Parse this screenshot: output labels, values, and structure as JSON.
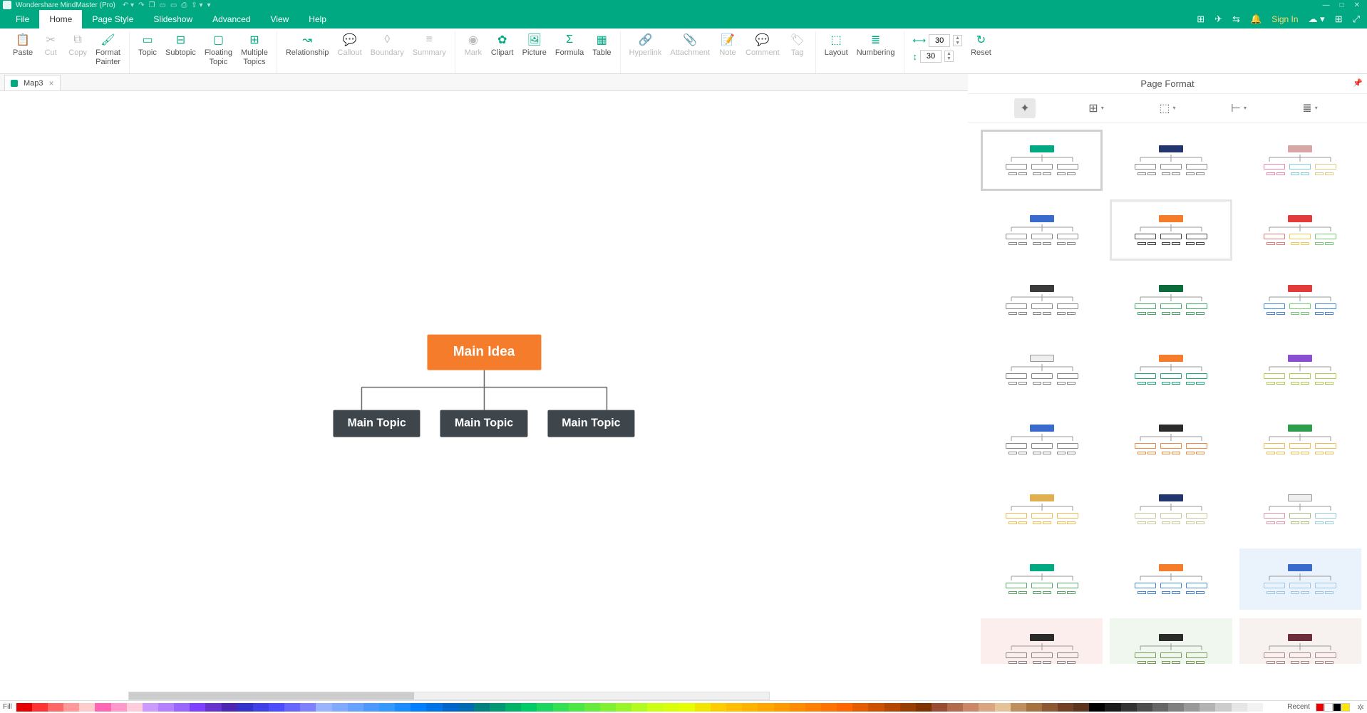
{
  "app": {
    "title": "Wondershare MindMaster (Pro)"
  },
  "menu": {
    "tabs": [
      "File",
      "Home",
      "Page Style",
      "Slideshow",
      "Advanced",
      "View",
      "Help"
    ],
    "active": 1,
    "signin": "Sign In"
  },
  "ribbon": {
    "paste": "Paste",
    "cut": "Cut",
    "copy": "Copy",
    "format_painter": "Format\nPainter",
    "topic": "Topic",
    "subtopic": "Subtopic",
    "floating": "Floating\nTopic",
    "multiple": "Multiple\nTopics",
    "relationship": "Relationship",
    "callout": "Callout",
    "boundary": "Boundary",
    "summary": "Summary",
    "mark": "Mark",
    "clipart": "Clipart",
    "picture": "Picture",
    "formula": "Formula",
    "table": "Table",
    "hyperlink": "Hyperlink",
    "attachment": "Attachment",
    "note": "Note",
    "comment": "Comment",
    "tag": "Tag",
    "layout": "Layout",
    "numbering": "Numbering",
    "width_val": "30",
    "height_val": "30",
    "reset": "Reset"
  },
  "doc": {
    "name": "Map3"
  },
  "mindmap": {
    "root": "Main Idea",
    "children": [
      "Main Topic",
      "Main Topic",
      "Main Topic"
    ]
  },
  "panel": {
    "title": "Page Format",
    "themes": [
      {
        "root": "#01a982",
        "k": "#888",
        "sel": true
      },
      {
        "root": "#22356e",
        "k": "#888"
      },
      {
        "root": "#d9a6a6",
        "k": "#d0b080",
        "multi": [
          "#e8a",
          "#8cd",
          "#dc8"
        ]
      },
      {
        "root": "#3a6acb",
        "k": "#888"
      },
      {
        "root": "#f47c2b",
        "k": "#444",
        "hov": true
      },
      {
        "root": "#e23b3b",
        "k": "#888",
        "multi": [
          "#e77",
          "#ec5",
          "#7c7"
        ]
      },
      {
        "root": "#3b3b3b",
        "k": "#888"
      },
      {
        "root": "#0b6b3a",
        "k": "#3a9",
        "multi": [
          "#4a6",
          "#4a6",
          "#4a6"
        ]
      },
      {
        "root": "#e23b3b",
        "k": "#888",
        "multi": [
          "#48d",
          "#7c7",
          "#48d"
        ]
      },
      {
        "root": "#eeeeee",
        "k": "#888",
        "bord": "#999"
      },
      {
        "root": "#f47c2b",
        "k": "#2a7a6e",
        "multi": [
          "#2a7",
          "#2a7",
          "#2a7"
        ]
      },
      {
        "root": "#8a4fd1",
        "k": "#a0c850",
        "multi": [
          "#ac5",
          "#ac5",
          "#ac5"
        ]
      },
      {
        "root": "#3a6acb",
        "k": "#888"
      },
      {
        "root": "#2b2b2b",
        "k": "#e08a4a",
        "multi": [
          "#e84",
          "#e84",
          "#e84"
        ]
      },
      {
        "root": "#2e9e4d",
        "k": "#e0b050",
        "multi": [
          "#eb5",
          "#eb5",
          "#eb5"
        ]
      },
      {
        "root": "#e0b050",
        "k": "#e0b050",
        "multi": [
          "#eb5",
          "#eb5",
          "#eb5"
        ]
      },
      {
        "root": "#22356e",
        "k": "#c9c9a0"
      },
      {
        "root": "#eeeeee",
        "k": "#d7a0a0",
        "bord": "#999",
        "multi": [
          "#d9a",
          "#ab8",
          "#9cd"
        ]
      },
      {
        "root": "#01a982",
        "k": "#4a9a5a",
        "multi": [
          "#5a6",
          "#5a6",
          "#5a6"
        ]
      },
      {
        "root": "#f47c2b",
        "k": "#3a6acb",
        "multi": [
          "#48d",
          "#48d",
          "#48d"
        ]
      },
      {
        "root": "#3a6acb",
        "k": "#9ec7e8",
        "tint": "blue"
      },
      {
        "root": "#2b2b2b",
        "k": "#888",
        "tint": "pink"
      },
      {
        "root": "#2b2b2b",
        "k": "#7a9a5a",
        "tint": "green"
      },
      {
        "root": "#6b2e3a",
        "k": "#a88",
        "tint": "brown"
      }
    ]
  },
  "colorbar": {
    "fill": "Fill",
    "recent": "Recent",
    "colors": [
      "#e60000",
      "#ff3333",
      "#ff6666",
      "#ff9999",
      "#ffcccc",
      "#ff66b3",
      "#ff99cc",
      "#ffccdd",
      "#cc99ff",
      "#b380ff",
      "#9966ff",
      "#8040ff",
      "#6633cc",
      "#4d26b3",
      "#3333cc",
      "#4040e6",
      "#4d4dff",
      "#6666ff",
      "#8080ff",
      "#99b3ff",
      "#80aaff",
      "#66a3ff",
      "#4d99ff",
      "#3399ff",
      "#1a8cff",
      "#0080ff",
      "#0073e6",
      "#0066cc",
      "#006bb3",
      "#008080",
      "#009973",
      "#00b366",
      "#00cc66",
      "#1ad65c",
      "#33e052",
      "#4de647",
      "#66eb3d",
      "#80f033",
      "#99f529",
      "#b3fa1f",
      "#ccff14",
      "#d9ff0a",
      "#e6ff00",
      "#f2e600",
      "#ffcc00",
      "#ffbf00",
      "#ffb300",
      "#ffa600",
      "#ff9900",
      "#ff8c00",
      "#ff8000",
      "#ff7300",
      "#ff6600",
      "#e65c00",
      "#cc5200",
      "#b34700",
      "#993d00",
      "#803300",
      "#994d33",
      "#b36b4d",
      "#cc8866",
      "#d9a680",
      "#e6c299",
      "#bf8f60",
      "#a67340",
      "#8c5933",
      "#734026",
      "#5c331f",
      "#000000",
      "#1a1a1a",
      "#333333",
      "#4d4d4d",
      "#666666",
      "#808080",
      "#999999",
      "#b3b3b3",
      "#cccccc",
      "#e6e6e6",
      "#f2f2f2",
      "#ffffff"
    ],
    "recent_colors": [
      "#e60000",
      "#ffffff",
      "#000000",
      "#ffe600"
    ]
  }
}
